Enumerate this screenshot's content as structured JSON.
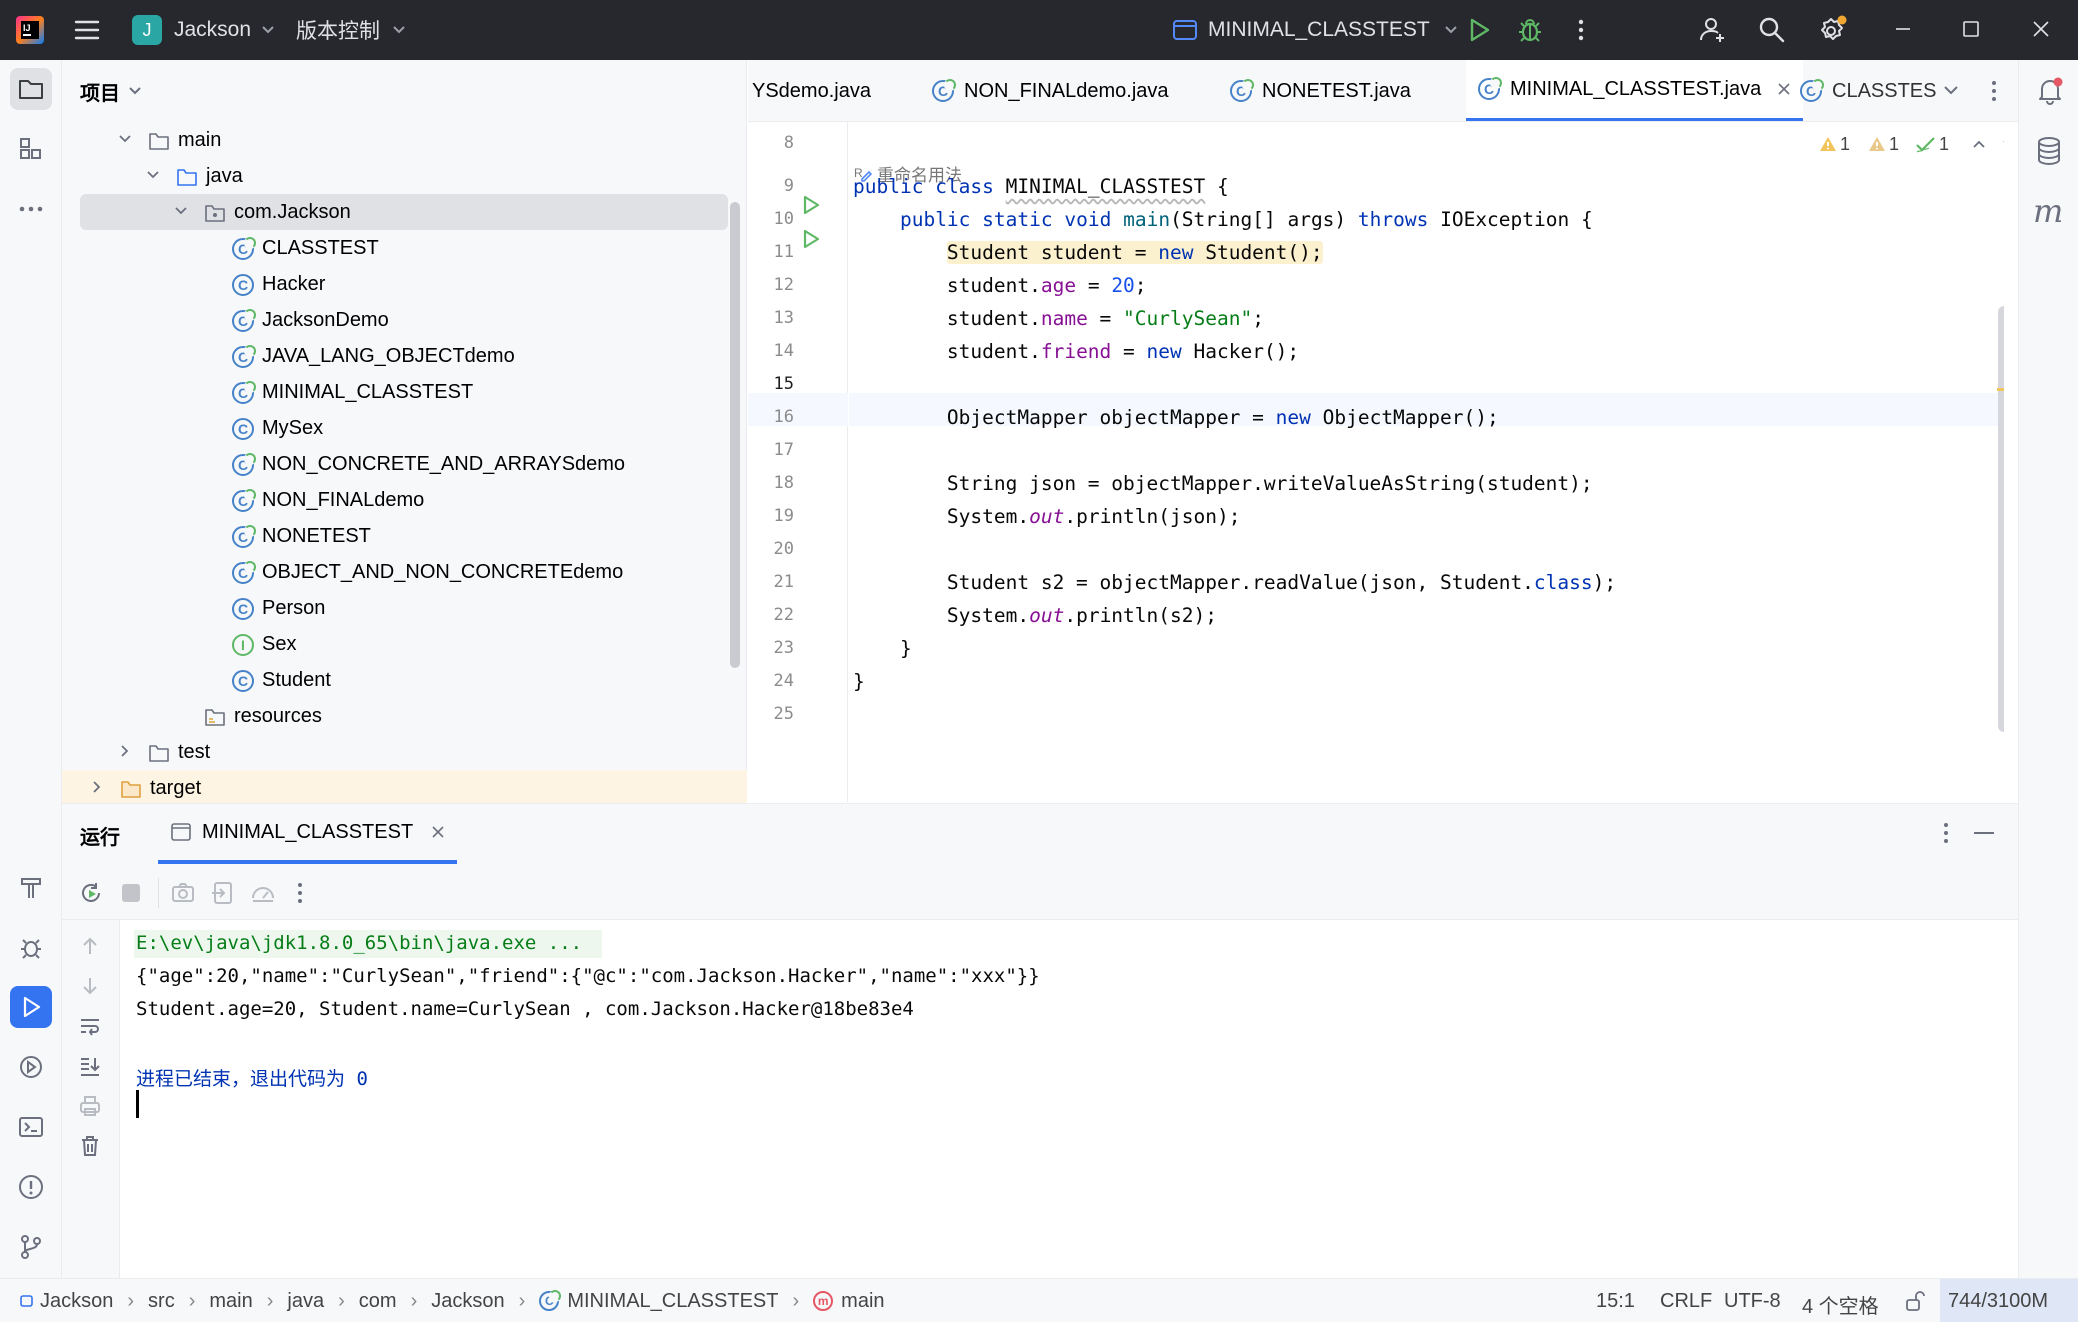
{
  "titlebar": {
    "project_initial": "J",
    "project_name": "Jackson",
    "vcs_label": "版本控制",
    "run_config": "MINIMAL_CLASSTEST",
    "colors": {
      "bg": "#27282e",
      "project_badge": "#2aa7a4",
      "run_green": "#5fb865"
    }
  },
  "project_panel": {
    "title": "项目",
    "tree": [
      {
        "label": "main",
        "type": "folder",
        "expanded": true
      },
      {
        "label": "java",
        "type": "src-folder",
        "expanded": true
      },
      {
        "label": "com.Jackson",
        "type": "package",
        "expanded": true,
        "selected": true
      },
      {
        "label": "CLASSTEST",
        "type": "runnable-class"
      },
      {
        "label": "Hacker",
        "type": "class"
      },
      {
        "label": "JacksonDemo",
        "type": "runnable-class"
      },
      {
        "label": "JAVA_LANG_OBJECTdemo",
        "type": "runnable-class"
      },
      {
        "label": "MINIMAL_CLASSTEST",
        "type": "runnable-class"
      },
      {
        "label": "MySex",
        "type": "class"
      },
      {
        "label": "NON_CONCRETE_AND_ARRAYSdemo",
        "type": "runnable-class"
      },
      {
        "label": "NON_FINALdemo",
        "type": "runnable-class"
      },
      {
        "label": "NONETEST",
        "type": "runnable-class"
      },
      {
        "label": "OBJECT_AND_NON_CONCRETEdemo",
        "type": "runnable-class"
      },
      {
        "label": "Person",
        "type": "class"
      },
      {
        "label": "Sex",
        "type": "interface"
      },
      {
        "label": "Student",
        "type": "class"
      },
      {
        "label": "resources",
        "type": "resources-folder"
      },
      {
        "label": "test",
        "type": "folder",
        "expanded": false
      },
      {
        "label": "target",
        "type": "excluded-folder",
        "expanded": false
      }
    ]
  },
  "editor": {
    "tabs": [
      {
        "label": "YSdemo.java"
      },
      {
        "label": "NON_FINALdemo.java"
      },
      {
        "label": "NONETEST.java"
      },
      {
        "label": "MINIMAL_CLASSTEST.java",
        "active": true
      },
      {
        "label": "CLASSTES"
      }
    ],
    "inspections": {
      "warnings": "1",
      "weak_warnings": "1",
      "ok": "1"
    },
    "usage_hint": "重命名用法",
    "line_numbers": [
      "8",
      "9",
      "10",
      "11",
      "12",
      "13",
      "14",
      "15",
      "16",
      "17",
      "18",
      "19",
      "20",
      "21",
      "22",
      "23",
      "24",
      "25"
    ],
    "current_line": "15",
    "code_lines": [
      "",
      "public class MINIMAL_CLASSTEST {",
      "    public static void main(String[] args) throws IOException {",
      "        Student student = new Student();",
      "        student.age = 20;",
      "        student.name = \"CurlySean\";",
      "        student.friend = new Hacker();",
      "",
      "        ObjectMapper objectMapper = new ObjectMapper();",
      "",
      "        String json = objectMapper.writeValueAsString(student);",
      "        System.out.println(json);",
      "",
      "        Student s2 = objectMapper.readValue(json, Student.class);",
      "        System.out.println(s2);",
      "    }",
      "}",
      ""
    ]
  },
  "run_panel": {
    "title": "运行",
    "tab_label": "MINIMAL_CLASSTEST",
    "output": [
      "E:\\ev\\java\\jdk1.8.0_65\\bin\\java.exe ...",
      "{\"age\":20,\"name\":\"CurlySean\",\"friend\":{\"@c\":\"com.Jackson.Hacker\",\"name\":\"xxx\"}}",
      "Student.age=20, Student.name=CurlySean , com.Jackson.Hacker@18be83e4",
      "",
      "进程已结束，退出代码为 0"
    ]
  },
  "statusbar": {
    "breadcrumb": [
      "Jackson",
      "src",
      "main",
      "java",
      "com",
      "Jackson",
      "MINIMAL_CLASSTEST",
      "main"
    ],
    "position": "15:1",
    "line_sep": "CRLF",
    "encoding": "UTF-8",
    "indent": "4 个空格",
    "memory": "744/3100M"
  }
}
